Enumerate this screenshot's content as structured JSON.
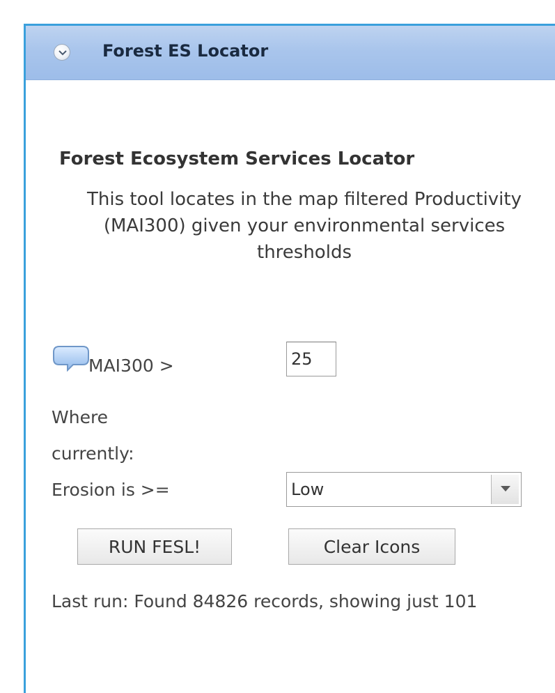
{
  "panel": {
    "title": "Forest ES Locator",
    "toggle_icon": "chevron-down-icon"
  },
  "tool": {
    "heading": "Forest Ecosystem Services Locator",
    "description": "This tool locates in the map filtered Productivity (MAI300) given your environmental services thresholds"
  },
  "form": {
    "info_icon": "speech-bubble-icon",
    "mai_label": "MAI300 >",
    "mai_value": "25",
    "where_label": "Where currently:",
    "erosion_label": "Erosion is >=",
    "erosion_selected": "Low"
  },
  "buttons": {
    "run_label": "RUN FESL!",
    "clear_label": "Clear Icons"
  },
  "status": {
    "last_run": "Last run: Found 84826 records, showing just 101"
  },
  "colors": {
    "panel_border": "#3aa0dc",
    "header_bg": "#a9c5ec",
    "text": "#333333"
  }
}
